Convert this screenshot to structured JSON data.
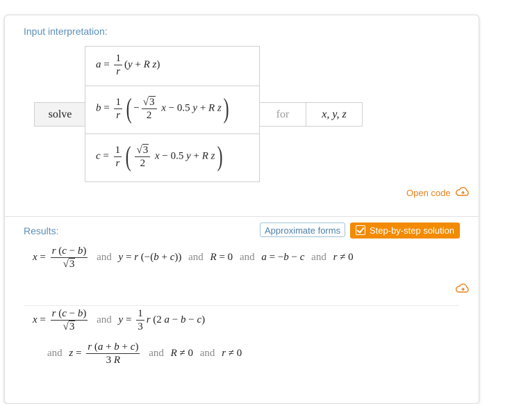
{
  "input": {
    "title": "Input interpretation:",
    "solve_label": "solve",
    "for_label": "for",
    "variables": "x, y, z",
    "open_code_label": "Open code"
  },
  "results": {
    "title": "Results:",
    "approx_label": "Approximate forms",
    "step_label": "Step-by-step solution",
    "word_and": "and"
  },
  "colors": {
    "accent": "#f28b00",
    "title": "#5b8fb9"
  }
}
